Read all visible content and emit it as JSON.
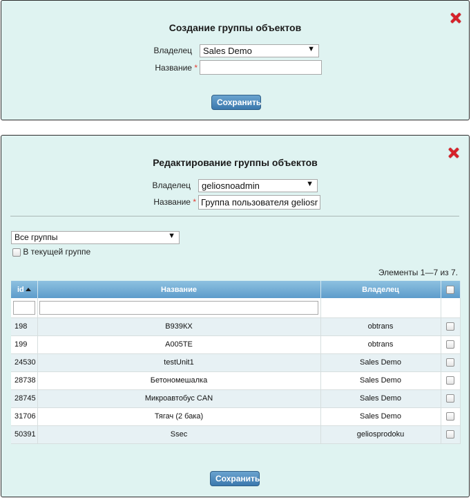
{
  "create_dialog": {
    "title": "Создание группы объектов",
    "owner_label": "Владелец",
    "owner_value": "Sales Demo",
    "name_label": "Название",
    "required_mark": "*",
    "name_value": "",
    "save_label": "Сохранить"
  },
  "edit_dialog": {
    "title": "Редактирование группы объектов",
    "owner_label": "Владелец",
    "owner_value": "geliosnoadmin",
    "name_label": "Название",
    "required_mark": "*",
    "name_value": "Группа пользователя geliosr",
    "group_filter_value": "Все группы",
    "in_current_group_label": "В текущей группе",
    "items_count": "Элементы 1—7 из 7.",
    "columns": {
      "id": "id",
      "name": "Название",
      "owner": "Владелец"
    },
    "rows": [
      {
        "id": "198",
        "name": "В939КХ",
        "owner": "obtrans"
      },
      {
        "id": "199",
        "name": "А005ТЕ",
        "owner": "obtrans"
      },
      {
        "id": "24530",
        "name": "testUnit1",
        "owner": "Sales Demo"
      },
      {
        "id": "28738",
        "name": "Бетономешалка",
        "owner": "Sales Demo"
      },
      {
        "id": "28745",
        "name": "Микроавтобус CAN",
        "owner": "Sales Demo"
      },
      {
        "id": "31706",
        "name": "Тягач (2 бака)",
        "owner": "Sales Demo"
      },
      {
        "id": "50391",
        "name": "Ssec",
        "owner": "geliosprodoku"
      }
    ],
    "save_label": "Сохранить"
  },
  "colors": {
    "dialog_bg": "#dff3f1",
    "close_red": "#d8222a",
    "header_blue": "#5d9ccb",
    "button_blue": "#3b78ad"
  }
}
